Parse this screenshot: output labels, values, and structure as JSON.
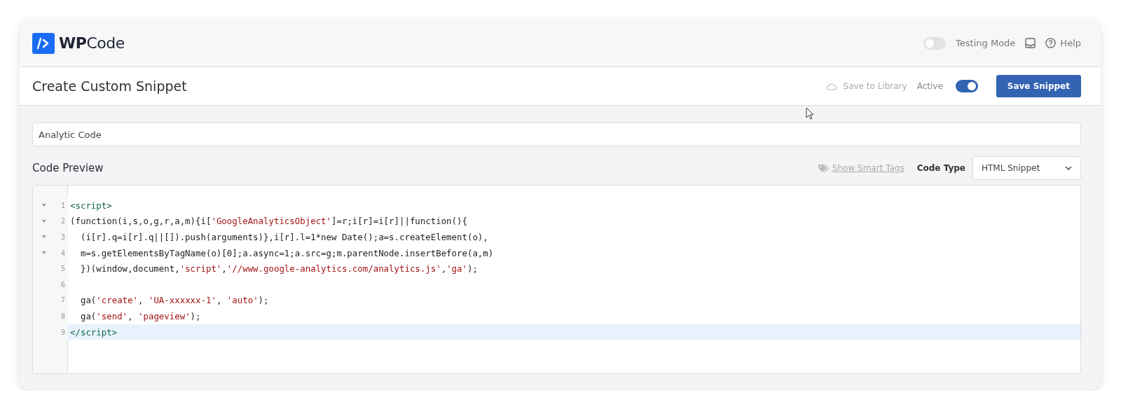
{
  "brand": {
    "bold": "WP",
    "light": "Code"
  },
  "header": {
    "testing_mode": {
      "label": "Testing Mode",
      "on": false
    },
    "help": "Help"
  },
  "title_bar": {
    "title": "Create Custom Snippet",
    "save_to_library": "Save to Library",
    "active": {
      "label": "Active",
      "on": true
    },
    "save_button": "Save Snippet"
  },
  "snippet_title": {
    "value": "Analytic Code"
  },
  "code_preview": {
    "heading": "Code Preview",
    "smart_tags_link": "Show Smart Tags",
    "code_type_label": "Code Type",
    "code_type_value": "HTML Snippet",
    "lines": [
      {
        "number": "1",
        "text": "<script>",
        "foldable": true,
        "active": false
      },
      {
        "number": "2",
        "text": "(function(i,s,o,g,r,a,m){i['GoogleAnalyticsObject']=r;i[r]=i[r]||function(){",
        "foldable": true,
        "active": false
      },
      {
        "number": "3",
        "text": "  (i[r].q=i[r].q||[]).push(arguments)},i[r].l=1*new Date();a=s.createElement(o),",
        "foldable": true,
        "active": false
      },
      {
        "number": "4",
        "text": "  m=s.getElementsByTagName(o)[0];a.async=1;a.src=g;m.parentNode.insertBefore(a,m)",
        "foldable": true,
        "active": false
      },
      {
        "number": "5",
        "text": "  })(window,document,'script','//www.google-analytics.com/analytics.js','ga');",
        "foldable": false,
        "active": false
      },
      {
        "number": "6",
        "foldable": false,
        "active": false
      },
      {
        "number": "7",
        "text": "  ga('create', 'UA-xxxxxx-1', 'auto');",
        "foldable": false,
        "active": false
      },
      {
        "number": "8",
        "text": "  ga('send', 'pageview');",
        "foldable": false,
        "active": false
      },
      {
        "number": "9",
        "text": "</script>",
        "foldable": false,
        "active": true
      }
    ]
  }
}
